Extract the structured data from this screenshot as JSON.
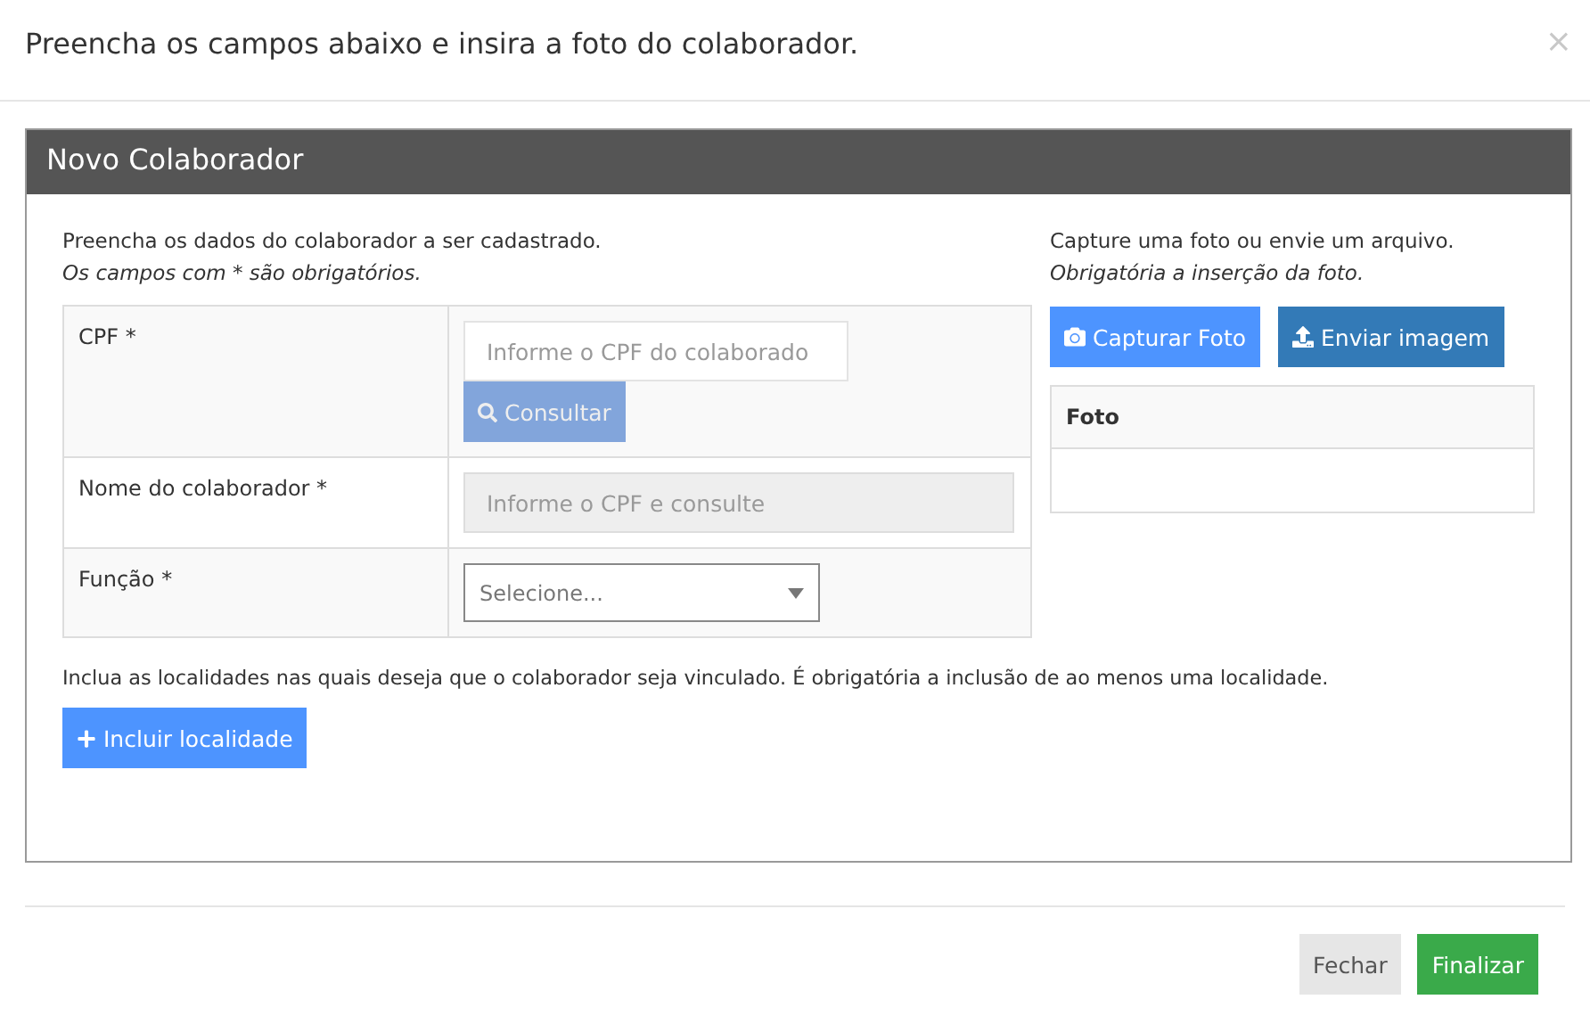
{
  "modal": {
    "title": "Preencha os campos abaixo e insira a foto do colaborador.",
    "close": "×"
  },
  "panel": {
    "title": "Novo Colaborador",
    "intro": "Preencha os dados do colaborador a ser cadastrado.",
    "note": "Os campos com * são obrigatórios.",
    "fields": [
      {
        "kind": "lookup",
        "label": "CPF *",
        "placeholder": "Informe o CPF do colaborado",
        "button": "Consultar",
        "button_disabled": true
      },
      {
        "kind": "text",
        "label": "Nome do colaborador *",
        "placeholder": "Informe o CPF e consulte",
        "disabled": true
      },
      {
        "kind": "select",
        "label": "Função *",
        "placeholder": "Selecione..."
      }
    ],
    "photo": {
      "intro": "Capture uma foto ou envie um arquivo.",
      "note": "Obrigatória a inserção da foto.",
      "buttons": [
        {
          "kind": "camera",
          "label": "Capturar Foto"
        },
        {
          "kind": "upload",
          "label": "Enviar imagem"
        }
      ],
      "table_header": "Foto"
    },
    "locations_text": "Inclua as localidades nas quais deseja que o colaborador seja vinculado. É obrigatória a inclusão de ao menos uma localidade.",
    "add_location": "Incluir localidade"
  },
  "footer": {
    "buttons": [
      {
        "kind": "secondary",
        "label": "Fechar"
      },
      {
        "kind": "primary",
        "label": "Finalizar"
      }
    ]
  }
}
